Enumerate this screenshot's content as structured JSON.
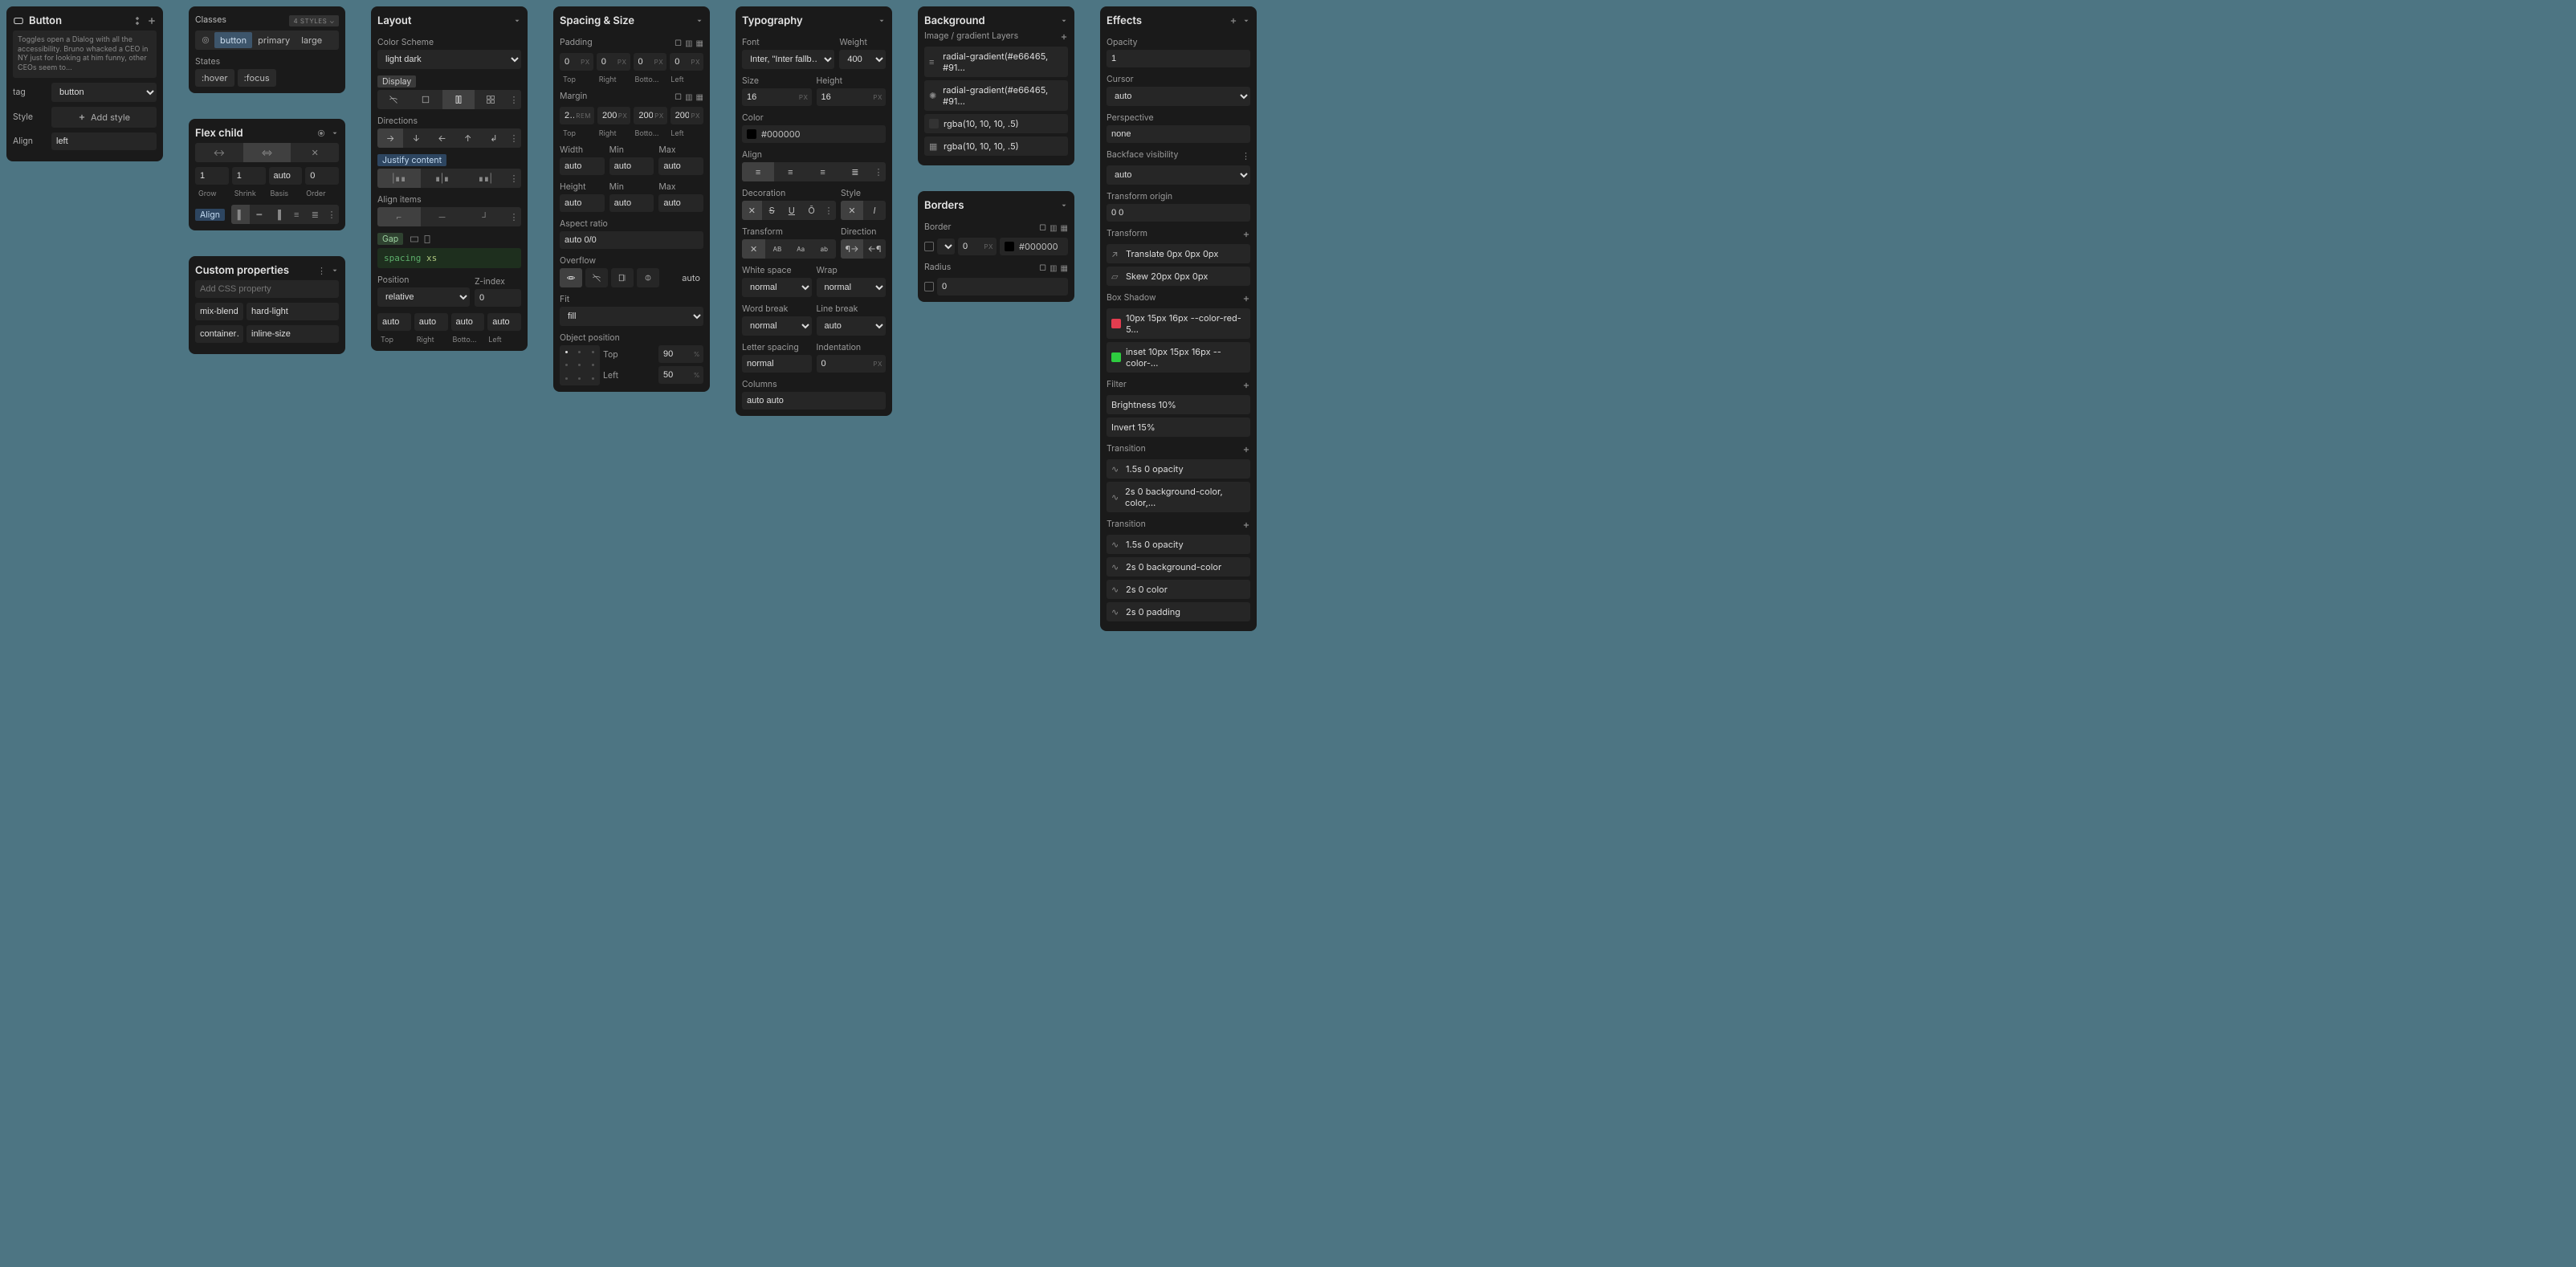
{
  "button_panel": {
    "title": "Button",
    "description": "Toggles open a Dialog with all the accessibility. Bruno whacked a CEO in NY just for looking at him funny, other CEOs seem to…",
    "tag_label": "tag",
    "tag_value": "button",
    "style_label": "Style",
    "add_style": "Add style",
    "align_label": "Align",
    "align_value": "left"
  },
  "classes_panel": {
    "title": "Classes",
    "styles_badge": "4 STYLES",
    "pills": [
      "button",
      "primary",
      "large"
    ],
    "states_label": "States",
    "states": [
      ":hover",
      ":focus"
    ]
  },
  "flex_child": {
    "title": "Flex child",
    "sizing_value": "✕",
    "grow": "1",
    "shrink": "1",
    "basis": "auto",
    "order": "0",
    "labels": [
      "Grow",
      "Shrink",
      "Basis",
      "Order"
    ],
    "align_label": "Align"
  },
  "custom_props": {
    "title": "Custom properties",
    "placeholder": "Add CSS property",
    "rows": [
      {
        "k": "mix-blend…",
        "v": "hard-light"
      },
      {
        "k": "container…",
        "v": "inline-size"
      }
    ]
  },
  "layout": {
    "title": "Layout",
    "color_scheme_label": "Color Scheme",
    "color_scheme_value": "light dark",
    "display_label": "Display",
    "directions_label": "Directions",
    "justify_label": "Justify content",
    "align_items_label": "Align items",
    "gap_label": "Gap",
    "gap_value_a": "spacing",
    "gap_value_b": "xs",
    "position_label": "Position",
    "position_value": "relative",
    "zindex_label": "Z-index",
    "zindex_value": "0",
    "inset": [
      "auto",
      "auto",
      "auto",
      "auto"
    ],
    "inset_labels": [
      "Top",
      "Right",
      "Botto…",
      "Left"
    ]
  },
  "spacing": {
    "title": "Spacing & Size",
    "padding_label": "Padding",
    "margin_label": "Margin",
    "padding": [
      "0",
      "0",
      "0",
      "0"
    ],
    "margin": [
      "2…",
      "200",
      "200",
      "200"
    ],
    "margin_units": [
      "REM",
      "PX",
      "PX",
      "PX"
    ],
    "side_labels": [
      "Top",
      "Right",
      "Botto…",
      "Left"
    ],
    "width_label": "Width",
    "min_label": "Min",
    "max_label": "Max",
    "width": "auto",
    "width_min": "auto",
    "width_max": "auto",
    "height_label": "Height",
    "height": "auto",
    "height_min": "auto",
    "height_max": "auto",
    "aspect_label": "Aspect ratio",
    "aspect_value": "auto 0/0",
    "overflow_label": "Overflow",
    "overflow_value": "auto",
    "fit_label": "Fit",
    "fit_value": "fill",
    "obj_pos_label": "Object position",
    "obj_top_label": "Top",
    "obj_top": "90",
    "obj_left_label": "Left",
    "obj_left": "50"
  },
  "typography": {
    "title": "Typography",
    "font_label": "Font",
    "weight_label": "Weight",
    "font_value": "Inter, \"Inter fallb…",
    "weight_value": "400",
    "size_label": "Size",
    "height_label": "Height",
    "size_value": "16",
    "height_value": "16",
    "color_label": "Color",
    "color_value": "#000000",
    "align_label": "Align",
    "decoration_label": "Decoration",
    "style_label": "Style",
    "transform_label": "Transform",
    "direction_label": "Direction",
    "ws_label": "White space",
    "ws_value": "normal",
    "wrap_label": "Wrap",
    "wrap_value": "normal",
    "wb_label": "Word break",
    "wb_value": "normal",
    "lb_label": "Line break",
    "lb_value": "auto",
    "ls_label": "Letter spacing",
    "ls_value": "normal",
    "ind_label": "Indentation",
    "ind_value": "0",
    "cols_label": "Columns",
    "cols_value": "auto auto"
  },
  "background": {
    "title": "Background",
    "layers_label": "Image / gradient Layers",
    "layers": [
      "radial-gradient(#e66465, #91…",
      "radial-gradient(#e66465, #91…",
      "rgba(10, 10, 10, .5)",
      "rgba(10, 10, 10, .5)"
    ]
  },
  "borders": {
    "title": "Borders",
    "border_label": "Border",
    "width_value": "0",
    "width_unit": "PX",
    "color_value": "#000000",
    "radius_label": "Radius",
    "radius_value": "0"
  },
  "effects": {
    "title": "Effects",
    "opacity_label": "Opacity",
    "opacity_value": "1",
    "cursor_label": "Cursor",
    "cursor_value": "auto",
    "perspective_label": "Perspective",
    "perspective_value": "none",
    "backface_label": "Backface visibility",
    "backface_value": "auto",
    "origin_label": "Transform origin",
    "origin_value": "0 0",
    "transform_label": "Transform",
    "transforms": [
      "Translate 0px 0px 0px",
      "Skew 20px 0px 0px"
    ],
    "bs_label": "Box Shadow",
    "shadows": [
      {
        "color": "swatch-red",
        "text": "10px 15px 16px --color-red-5…"
      },
      {
        "color": "swatch-green",
        "text": "inset 10px 15px 16px --color-…"
      }
    ],
    "filter_label": "Filter",
    "filters": [
      "Brightness 10%",
      "Invert 15%"
    ],
    "transition_label": "Transition",
    "transitions_a": [
      "1.5s 0 opacity",
      "2s 0 background-color, color,…"
    ],
    "transitions_b": [
      "1.5s 0 opacity",
      "2s 0 background-color",
      "2s 0 color",
      "2s 0 padding"
    ]
  }
}
